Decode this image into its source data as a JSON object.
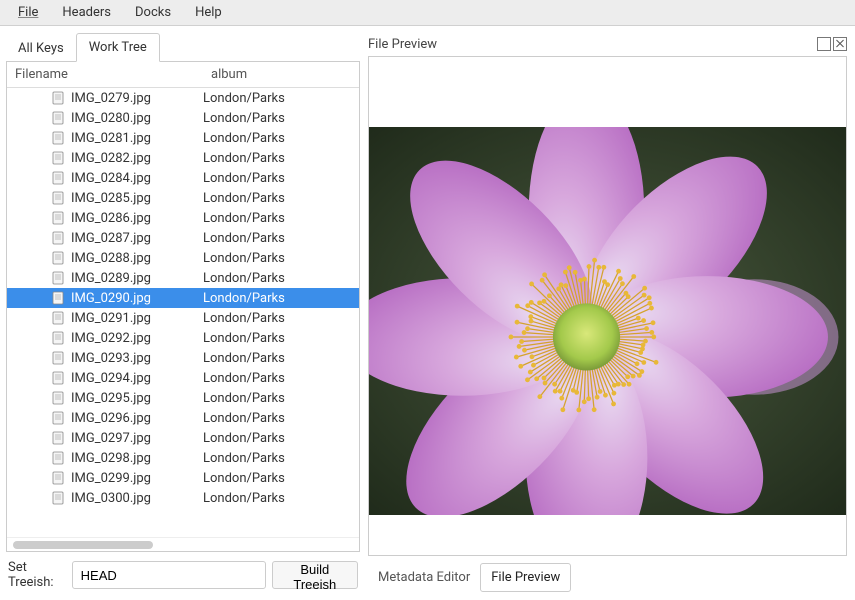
{
  "menubar": [
    "File",
    "Headers",
    "Docks",
    "Help"
  ],
  "left_tabs": [
    "All Keys",
    "Work Tree"
  ],
  "left_tab_active": 1,
  "columns": {
    "filename": "Filename",
    "album": "album"
  },
  "files": [
    {
      "name": "IMG_0279.jpg",
      "album": "London/Parks"
    },
    {
      "name": "IMG_0280.jpg",
      "album": "London/Parks"
    },
    {
      "name": "IMG_0281.jpg",
      "album": "London/Parks"
    },
    {
      "name": "IMG_0282.jpg",
      "album": "London/Parks"
    },
    {
      "name": "IMG_0284.jpg",
      "album": "London/Parks"
    },
    {
      "name": "IMG_0285.jpg",
      "album": "London/Parks"
    },
    {
      "name": "IMG_0286.jpg",
      "album": "London/Parks"
    },
    {
      "name": "IMG_0287.jpg",
      "album": "London/Parks"
    },
    {
      "name": "IMG_0288.jpg",
      "album": "London/Parks"
    },
    {
      "name": "IMG_0289.jpg",
      "album": "London/Parks"
    },
    {
      "name": "IMG_0290.jpg",
      "album": "London/Parks",
      "selected": true
    },
    {
      "name": "IMG_0291.jpg",
      "album": "London/Parks"
    },
    {
      "name": "IMG_0292.jpg",
      "album": "London/Parks"
    },
    {
      "name": "IMG_0293.jpg",
      "album": "London/Parks"
    },
    {
      "name": "IMG_0294.jpg",
      "album": "London/Parks"
    },
    {
      "name": "IMG_0295.jpg",
      "album": "London/Parks"
    },
    {
      "name": "IMG_0296.jpg",
      "album": "London/Parks"
    },
    {
      "name": "IMG_0297.jpg",
      "album": "London/Parks"
    },
    {
      "name": "IMG_0298.jpg",
      "album": "London/Parks"
    },
    {
      "name": "IMG_0299.jpg",
      "album": "London/Parks"
    },
    {
      "name": "IMG_0300.jpg",
      "album": "London/Parks"
    }
  ],
  "treeish": {
    "label": "Set Treeish:",
    "value": "HEAD",
    "button": "Build Treeish"
  },
  "preview": {
    "title": "File Preview"
  },
  "right_tabs": [
    "Metadata Editor",
    "File Preview"
  ],
  "right_tab_active": 1
}
